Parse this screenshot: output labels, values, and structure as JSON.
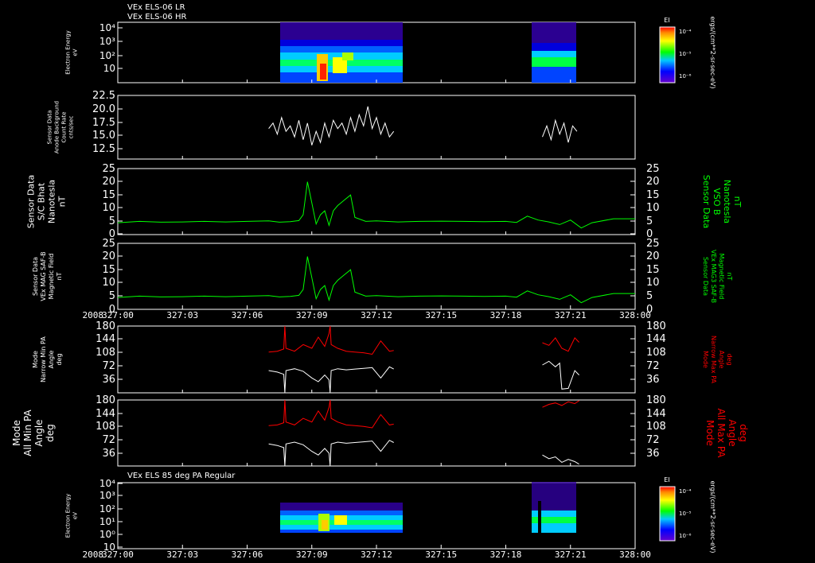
{
  "header": {
    "line1": "VEx ELS-06 LR",
    "line2": "VEx ELS-06 HR"
  },
  "panel7_title": "VEx ELS 85 deg PA Regular",
  "year": "2008",
  "x_ticks": [
    "327:00",
    "327:03",
    "327:06",
    "327:09",
    "327:12",
    "327:15",
    "327:18",
    "327:21",
    "328:00"
  ],
  "colors": {
    "background": "#000000",
    "axis": "#ffffff",
    "green": "#00ff00",
    "red": "#ff0000",
    "white": "#ffffff"
  },
  "chart_data": [
    {
      "type": "heatmap",
      "panel": "p1",
      "title": "VEx ELS-06 LR / VEx ELS-06 HR",
      "ylabel_lines": [
        "Electron Energy",
        "eV"
      ],
      "y_scale": "log",
      "y_ticks": [
        "10",
        "10²",
        "10³",
        "10⁴"
      ],
      "colorbar": {
        "title": "EI",
        "unit": "ergs/(cm**2-sr-sec-eV)",
        "ticks": [
          "10⁻⁴",
          "10⁻⁵",
          "10⁻⁶"
        ]
      },
      "coverage": [
        [
          "327:07",
          "327:12.8"
        ],
        [
          "327:19.7",
          "327:21.4"
        ]
      ]
    },
    {
      "type": "line",
      "panel": "p2",
      "ylabel_lines": [
        "Sensor Data",
        "Anode Background",
        "Count Rate",
        "cnts/sec"
      ],
      "y_ticks": [
        "12.5",
        "15.0",
        "17.5",
        "20.0",
        "22.5"
      ],
      "ylim": [
        11,
        22.5
      ],
      "series": [
        {
          "color": "white",
          "segments": [
            {
              "x": [
                7.0,
                7.2,
                7.4,
                7.6,
                7.8,
                8.0,
                8.2,
                8.4,
                8.6,
                8.8,
                9.0,
                9.2,
                9.4,
                9.6,
                9.8,
                10.0,
                10.2,
                10.4,
                10.6,
                10.8,
                11.0,
                11.2,
                11.4,
                11.6,
                11.8,
                12.0,
                12.2,
                12.4,
                12.6,
                12.8
              ],
              "y": [
                16.5,
                17.5,
                15.5,
                18.5,
                16.0,
                17.0,
                15.0,
                18.0,
                14.5,
                17.5,
                13.5,
                16.0,
                14.0,
                17.5,
                15.0,
                18.0,
                16.5,
                17.5,
                15.5,
                18.5,
                16.0,
                19.0,
                17.0,
                20.5,
                16.5,
                18.5,
                15.5,
                17.5,
                15.0,
                16.0
              ]
            },
            {
              "x": [
                19.7,
                19.9,
                20.1,
                20.3,
                20.5,
                20.7,
                20.9,
                21.1,
                21.3
              ],
              "y": [
                15.0,
                17.0,
                14.5,
                18.0,
                15.5,
                17.5,
                14.0,
                17.0,
                16.0
              ]
            }
          ]
        }
      ]
    },
    {
      "type": "line",
      "panel": "p3",
      "ylabel_lines": [
        "Sensor Data",
        "S/C Bhat",
        "Nanotesla",
        "nT"
      ],
      "ylabel_right_lines": [
        "Sensor Data",
        "VSO B",
        "Nanotesla",
        "nT"
      ],
      "y_ticks": [
        "0",
        "5",
        "10",
        "15",
        "20",
        "25"
      ],
      "ylim": [
        0,
        25
      ],
      "series": [
        {
          "color": "green",
          "x": [
            0,
            1,
            2,
            3,
            4,
            5,
            6,
            7,
            7.5,
            8,
            8.4,
            8.6,
            8.8,
            9.0,
            9.2,
            9.4,
            9.6,
            9.8,
            10.0,
            10.2,
            10.5,
            10.8,
            11.0,
            11.5,
            12,
            13,
            14,
            15,
            16,
            17,
            18,
            18.5,
            19,
            19.5,
            20,
            20.5,
            21,
            21.5,
            22,
            23,
            24
          ],
          "y": [
            4.5,
            5,
            4.7,
            4.8,
            5,
            4.8,
            5,
            5.2,
            4.7,
            4.9,
            5.3,
            7.5,
            20,
            12,
            4,
            7.5,
            9,
            3.5,
            9,
            11,
            13,
            15,
            6.5,
            5,
            5.2,
            4.8,
            5,
            5.1,
            5,
            4.9,
            5,
            4.6,
            7,
            5.5,
            4.8,
            3.8,
            5.5,
            2.5,
            4.5,
            6,
            6
          ]
        }
      ]
    },
    {
      "type": "line",
      "panel": "p4",
      "ylabel_lines": [
        "Sensor Data",
        "VEx MAG SAF-B",
        "Magnetic Field",
        "nT"
      ],
      "ylabel_right_lines": [
        "Sensor Data",
        "VEx MAG3 SAF-B",
        "Magnetic Field",
        "nT"
      ],
      "y_ticks": [
        "0",
        "5",
        "10",
        "15",
        "20",
        "25"
      ],
      "ylim": [
        0,
        25
      ],
      "series": [
        {
          "color": "green",
          "x": [
            0,
            1,
            2,
            3,
            4,
            5,
            6,
            7,
            7.5,
            8,
            8.4,
            8.6,
            8.8,
            9.0,
            9.2,
            9.4,
            9.6,
            9.8,
            10.0,
            10.2,
            10.5,
            10.8,
            11.0,
            11.5,
            12,
            13,
            14,
            15,
            16,
            17,
            18,
            18.5,
            19,
            19.5,
            20,
            20.5,
            21,
            21.5,
            22,
            23,
            24
          ],
          "y": [
            4.5,
            5,
            4.7,
            4.8,
            5,
            4.8,
            5,
            5.2,
            4.7,
            4.9,
            5.3,
            7.5,
            20,
            12,
            4,
            7.5,
            9,
            3.5,
            9,
            11,
            13,
            15,
            6.5,
            5,
            5.2,
            4.8,
            5,
            5.1,
            5,
            4.9,
            5,
            4.6,
            7,
            5.5,
            4.8,
            3.8,
            5.5,
            2.5,
            4.5,
            6,
            6
          ]
        }
      ]
    },
    {
      "type": "line",
      "panel": "p5",
      "ylabel_lines": [
        "Mode",
        "Narrow Min PA",
        "Angle",
        "deg"
      ],
      "ylabel_right_lines": [
        "Mode",
        "Narrow Max PA",
        "Angle",
        "deg"
      ],
      "y_ticks": [
        "36",
        "72",
        "108",
        "144",
        "180"
      ],
      "ylim": [
        0,
        180
      ],
      "series": [
        {
          "color": "red",
          "segments": [
            {
              "x": [
                7.0,
                7.4,
                7.7,
                7.75,
                7.8,
                8.2,
                8.6,
                9.0,
                9.3,
                9.6,
                9.8,
                9.85,
                9.9,
                10.2,
                10.6,
                11.0,
                11.4,
                11.8,
                12.2,
                12.6,
                12.8
              ],
              "y": [
                110,
                112,
                118,
                180,
                120,
                112,
                130,
                120,
                150,
                125,
                160,
                180,
                130,
                120,
                112,
                110,
                108,
                104,
                140,
                112,
                114
              ]
            },
            {
              "x": [
                19.7,
                20.0,
                20.3,
                20.6,
                20.9,
                21.2,
                21.4
              ],
              "y": [
                135,
                128,
                148,
                120,
                112,
                148,
                136
              ]
            }
          ]
        },
        {
          "color": "white",
          "segments": [
            {
              "x": [
                7.0,
                7.4,
                7.7,
                7.75,
                7.8,
                8.2,
                8.6,
                9.0,
                9.3,
                9.6,
                9.8,
                9.85,
                9.9,
                10.2,
                10.6,
                11.0,
                11.4,
                11.8,
                12.2,
                12.6,
                12.8
              ],
              "y": [
                60,
                56,
                50,
                0,
                60,
                65,
                58,
                40,
                30,
                48,
                35,
                0,
                60,
                65,
                62,
                64,
                66,
                68,
                40,
                70,
                64
              ]
            },
            {
              "x": [
                19.7,
                20.0,
                20.3,
                20.5,
                20.6,
                20.9,
                21.2,
                21.4
              ],
              "y": [
                75,
                85,
                70,
                80,
                10,
                12,
                60,
                48
              ]
            }
          ]
        }
      ]
    },
    {
      "type": "line",
      "panel": "p6",
      "ylabel_lines": [
        "Mode",
        "All Min PA",
        "Angle",
        "deg"
      ],
      "ylabel_right_lines": [
        "Mode",
        "All Max PA",
        "Angle",
        "deg"
      ],
      "y_ticks": [
        "36",
        "72",
        "108",
        "144",
        "180"
      ],
      "ylim": [
        0,
        180
      ],
      "series": [
        {
          "color": "red",
          "segments": [
            {
              "x": [
                7.0,
                7.4,
                7.7,
                7.75,
                7.8,
                8.2,
                8.6,
                9.0,
                9.3,
                9.6,
                9.8,
                9.85,
                9.9,
                10.2,
                10.6,
                11.0,
                11.4,
                11.8,
                12.2,
                12.6,
                12.8
              ],
              "y": [
                110,
                112,
                118,
                180,
                120,
                112,
                130,
                120,
                150,
                125,
                160,
                180,
                130,
                120,
                112,
                110,
                108,
                104,
                140,
                112,
                114
              ]
            },
            {
              "x": [
                19.7,
                20.0,
                20.3,
                20.6,
                20.9,
                21.2,
                21.4
              ],
              "y": [
                160,
                168,
                172,
                165,
                175,
                170,
                178
              ]
            }
          ]
        },
        {
          "color": "white",
          "segments": [
            {
              "x": [
                7.0,
                7.4,
                7.7,
                7.75,
                7.8,
                8.2,
                8.6,
                9.0,
                9.3,
                9.6,
                9.8,
                9.85,
                9.9,
                10.2,
                10.6,
                11.0,
                11.4,
                11.8,
                12.2,
                12.6,
                12.8
              ],
              "y": [
                60,
                56,
                50,
                0,
                60,
                65,
                58,
                40,
                30,
                48,
                35,
                0,
                60,
                65,
                62,
                64,
                66,
                68,
                40,
                70,
                64
              ]
            },
            {
              "x": [
                19.7,
                20.0,
                20.3,
                20.6,
                20.9,
                21.2,
                21.4
              ],
              "y": [
                30,
                20,
                25,
                10,
                18,
                12,
                5
              ]
            }
          ]
        }
      ]
    },
    {
      "type": "heatmap",
      "panel": "p7",
      "title": "VEx ELS 85 deg PA Regular",
      "ylabel_lines": [
        "Electron Energy",
        "eV"
      ],
      "y_scale": "log",
      "y_ticks": [
        "10",
        "10⁰",
        "10¹",
        "10²",
        "10³",
        "10⁴"
      ],
      "colorbar": {
        "title": "EI",
        "unit": "ergs/(cm**2-sr-sec-eV)",
        "ticks": [
          "10⁻⁴",
          "10⁻⁵",
          "10⁻⁶"
        ]
      },
      "coverage": [
        [
          "327:07",
          "327:12.8"
        ],
        [
          "327:19.7",
          "327:21.4"
        ]
      ]
    }
  ]
}
